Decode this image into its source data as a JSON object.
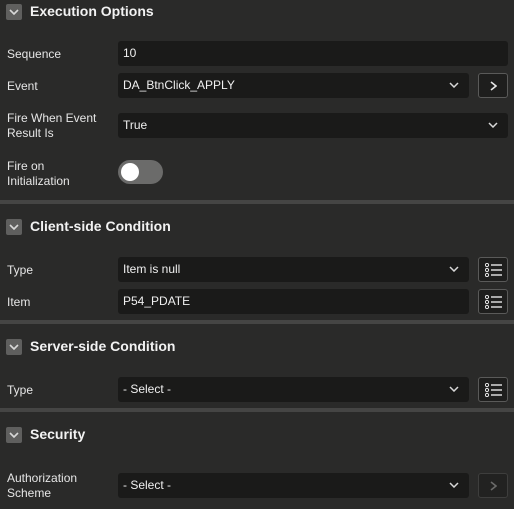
{
  "execution_options": {
    "title": "Execution Options",
    "sequence": {
      "label": "Sequence",
      "value": "10"
    },
    "event": {
      "label": "Event",
      "value": "DA_BtnClick_APPLY"
    },
    "fire_when": {
      "label_line1": "Fire When Event",
      "label_line2": "Result Is",
      "value": "True"
    },
    "fire_on_init": {
      "label_line1": "Fire on",
      "label_line2": "Initialization",
      "enabled": false
    }
  },
  "client_condition": {
    "title": "Client-side Condition",
    "type": {
      "label": "Type",
      "value": "Item is null"
    },
    "item": {
      "label": "Item",
      "value": "P54_PDATE"
    }
  },
  "server_condition": {
    "title": "Server-side Condition",
    "type": {
      "label": "Type",
      "value": "- Select -"
    }
  },
  "security": {
    "title": "Security",
    "authorization": {
      "label_line1": "Authorization",
      "label_line2": "Scheme",
      "value": "- Select -"
    }
  },
  "icons": {
    "collapse": "chevron-down-icon",
    "go_to": "chevron-right-icon",
    "list": "list-icon",
    "dropdown": "chevron-down-icon"
  },
  "colors": {
    "background": "#2a2a29",
    "field": "#1a1a19",
    "divider": "#454544",
    "toggle_off": "#6b6b6a"
  }
}
